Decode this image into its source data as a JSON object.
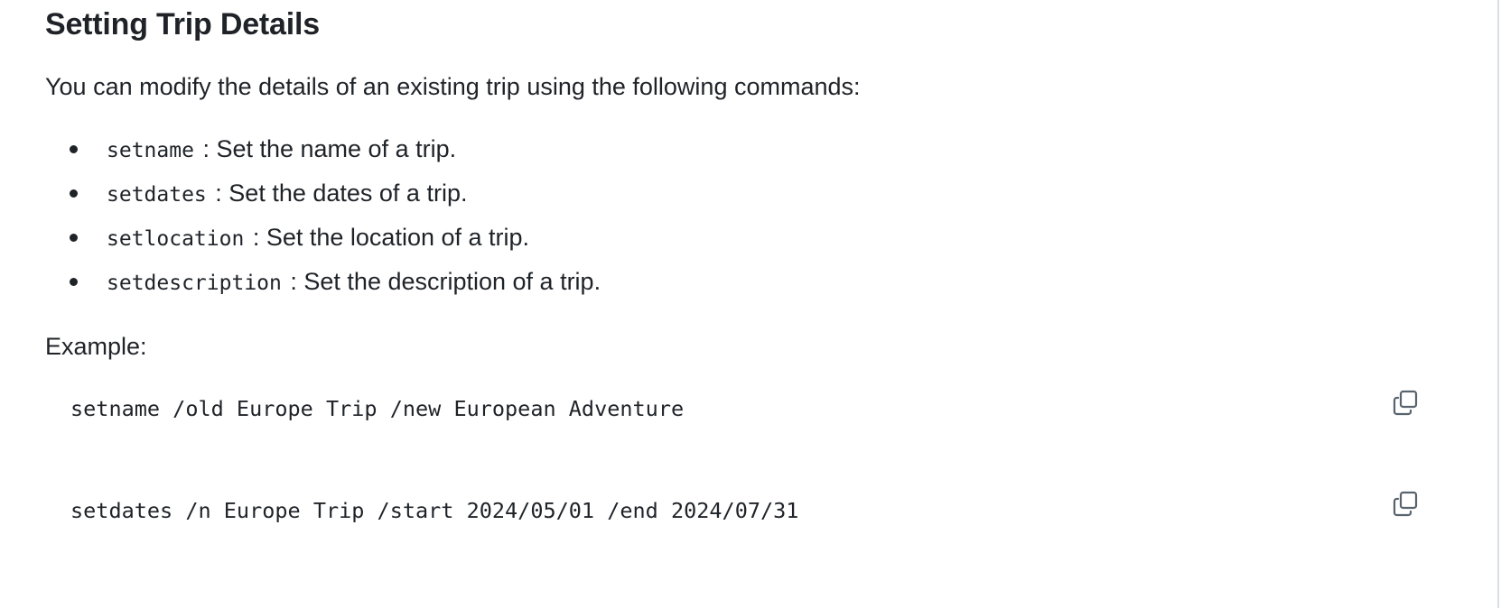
{
  "section": {
    "title": "Setting Trip Details",
    "intro": "You can modify the details of an existing trip using the following commands:"
  },
  "commands": [
    {
      "code": "setname",
      "desc": ": Set the name of a trip."
    },
    {
      "code": "setdates",
      "desc": ": Set the dates of a trip."
    },
    {
      "code": "setlocation",
      "desc": ": Set the location of a trip."
    },
    {
      "code": "setdescription",
      "desc": ": Set the description of a trip."
    }
  ],
  "example": {
    "label": "Example:",
    "blocks": [
      {
        "code": "setname /old Europe Trip /new European Adventure",
        "copy_icon": "copy-icon"
      },
      {
        "code": "setdates /n Europe Trip /start 2024/05/01 /end 2024/07/31",
        "copy_icon": "copy-icon"
      }
    ]
  }
}
